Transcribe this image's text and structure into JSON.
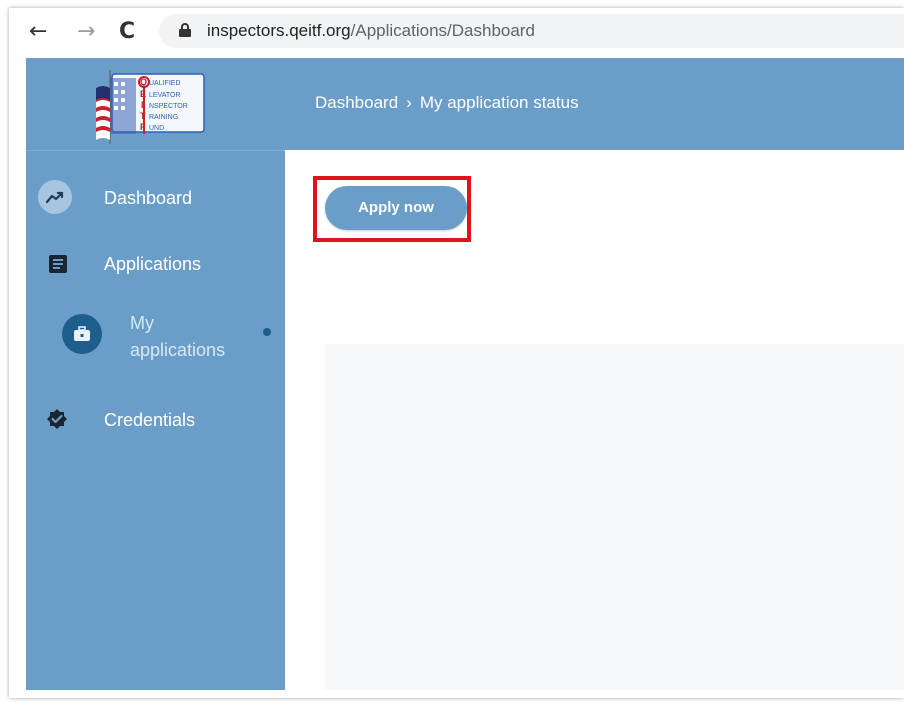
{
  "browser": {
    "back_icon": "←",
    "forward_icon": "→",
    "reload_icon": "C",
    "url_host": "inspectors.qeitf.org",
    "url_path": "/Applications/Dashboard"
  },
  "logo": {
    "lines": [
      "UALIFIED",
      "LEVATOR",
      "NSPECTOR",
      "RAINING",
      "UND"
    ],
    "initials": [
      "Q",
      "E",
      "I",
      "T",
      "F"
    ]
  },
  "sidebar": {
    "items": [
      {
        "label": "Dashboard",
        "icon": "trending-up-icon"
      },
      {
        "label": "Applications",
        "icon": "document-icon"
      },
      {
        "label": "My applications",
        "icon": "briefcase-icon"
      },
      {
        "label": "Credentials",
        "icon": "verified-badge-icon"
      }
    ]
  },
  "header": {
    "breadcrumb": [
      "Dashboard",
      "My application status"
    ],
    "separator": "›"
  },
  "main": {
    "apply_button": "Apply now"
  },
  "colors": {
    "sidebar_bg": "#6a9ec8",
    "accent_dark": "#1e5e8c",
    "highlight": "#e0141e"
  }
}
